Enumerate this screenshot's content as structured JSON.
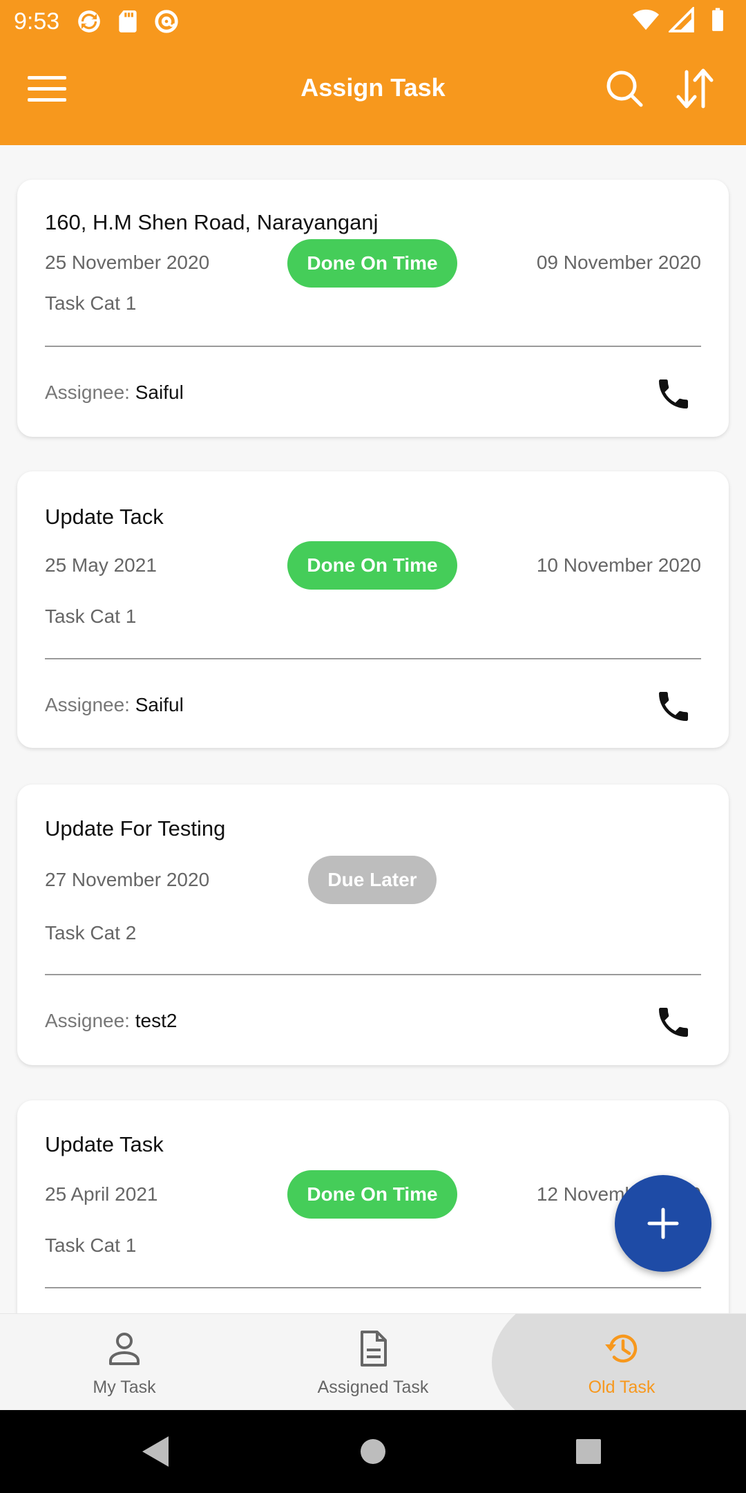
{
  "status_bar": {
    "time": "9:53"
  },
  "app_bar": {
    "title": "Assign Task"
  },
  "colors": {
    "primary": "#F7981D",
    "done": "#45CD59",
    "due_later": "#BDBDBD",
    "fab": "#1E4BA6"
  },
  "tasks": [
    {
      "title": "160, H.M Shen Road, Narayanganj",
      "start_date": "25 November 2020",
      "status": "Done On Time",
      "due_date": "09 November 2020",
      "category": "Task Cat 1",
      "assignee_label": "Assignee: ",
      "assignee": "Saiful"
    },
    {
      "title": "Update Tack",
      "start_date": "25 May 2021",
      "status": "Done On Time",
      "due_date": "10 November 2020",
      "category": "Task Cat 1",
      "assignee_label": "Assignee: ",
      "assignee": "Saiful"
    },
    {
      "title": "Update For Testing",
      "start_date": "27 November 2020",
      "status": "Due Later",
      "due_date": "",
      "category": "Task Cat 2",
      "assignee_label": "Assignee: ",
      "assignee": "test2"
    },
    {
      "title": "Update Task",
      "start_date": "25 April 2021",
      "status": "Done On Time",
      "due_date": "12 November 2020",
      "category": "Task Cat 1"
    }
  ],
  "bottom_nav": {
    "items": [
      {
        "label": "My Task",
        "icon": "person-icon",
        "active": false
      },
      {
        "label": "Assigned Task",
        "icon": "document-icon",
        "active": false
      },
      {
        "label": "Old Task",
        "icon": "history-icon",
        "active": true
      }
    ]
  }
}
